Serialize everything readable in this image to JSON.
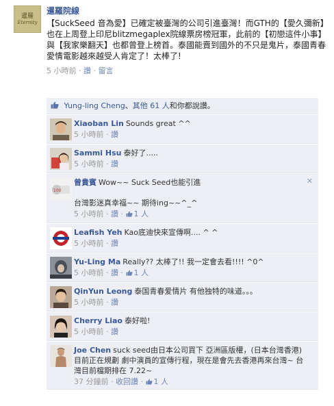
{
  "post": {
    "page_thumb_line1": "暹羅",
    "page_thumb_line2": "Eternity",
    "page_name": "暹羅院線",
    "text": "【SuckSeed 音為愛】已確定被臺灣的公司引進臺灣！而GTH的【愛久彌新】也在上周登上印尼blitzmegaplex院線票房榜冠軍，此前的【初戀這件小事】與【我家樂翻天】也都曾登上榜首。泰國能賣到國外的不只是鬼片，泰國青春愛情電影越來越受人肯定了！太棒了!",
    "time": "5 小時前",
    "like_label": "讚",
    "comment_label": "留言",
    "separator": "·"
  },
  "likes": {
    "name": "Yung-ling Cheng",
    "connector": "、",
    "others": "其他 61 人",
    "suffix": "和你都說讚。"
  },
  "comments": [
    {
      "author": "Xiaoban Lin",
      "text": "Sounds great ^^",
      "time": "5 小時前",
      "like": "讚",
      "likes": "",
      "avatar": "xiaoban"
    },
    {
      "author": "Sammi Hsu",
      "text": "泰好了.....",
      "time": "5 小時前",
      "like": "讚",
      "likes": "",
      "avatar": "sammi"
    },
    {
      "author": "曾貴賓",
      "text": "Wow~~ Suck Seed也能引進\n\n台灣影迷真幸福~~ 期待ing~~^_^",
      "time": "5 小時前",
      "like": "讚",
      "likes": "1 人",
      "avatar": "zeng"
    },
    {
      "author": "Leafish Yeh",
      "text": "Kao底迪快來宣傳啊.... ^ ^",
      "time": "5 小時前",
      "like": "讚",
      "likes": "",
      "avatar": "leafish"
    },
    {
      "author": "Yu-Ling Ma",
      "text": "Really?? 太棒了!! 我一定會去看!!!! ^0^",
      "time": "5 小時前",
      "like": "讚",
      "likes": "1 人",
      "avatar": "yuling"
    },
    {
      "author": "QinYun Leong",
      "text": "泰国青春爱情片 有他独特的味道。。。",
      "time": "5 小時前",
      "like": "讚",
      "likes": "",
      "avatar": "qinyun"
    },
    {
      "author": "Cherry Liao",
      "text": "泰好啦!",
      "time": "5 小時前",
      "like": "讚",
      "likes": "",
      "avatar": "cherry"
    },
    {
      "author": "Joe Chen",
      "text": "suck seed由日本公司買下 亞洲區版權，(日本台灣香港)目前正在規劃 劇中演員的宣傳行程，現在是會先去香港再來台灣~ 台灣目前檔期排在 7.22~",
      "time": "37 分鐘前",
      "like": "收回讚",
      "likes": "1 人",
      "avatar": "joe"
    }
  ],
  "colors": {
    "link": "#3b5998",
    "comment_bg": "#edeff4",
    "likes_bg": "#eceff5",
    "meta": "#999999"
  },
  "icons": {
    "like": "thumbs-up-icon",
    "close": "close-icon"
  }
}
